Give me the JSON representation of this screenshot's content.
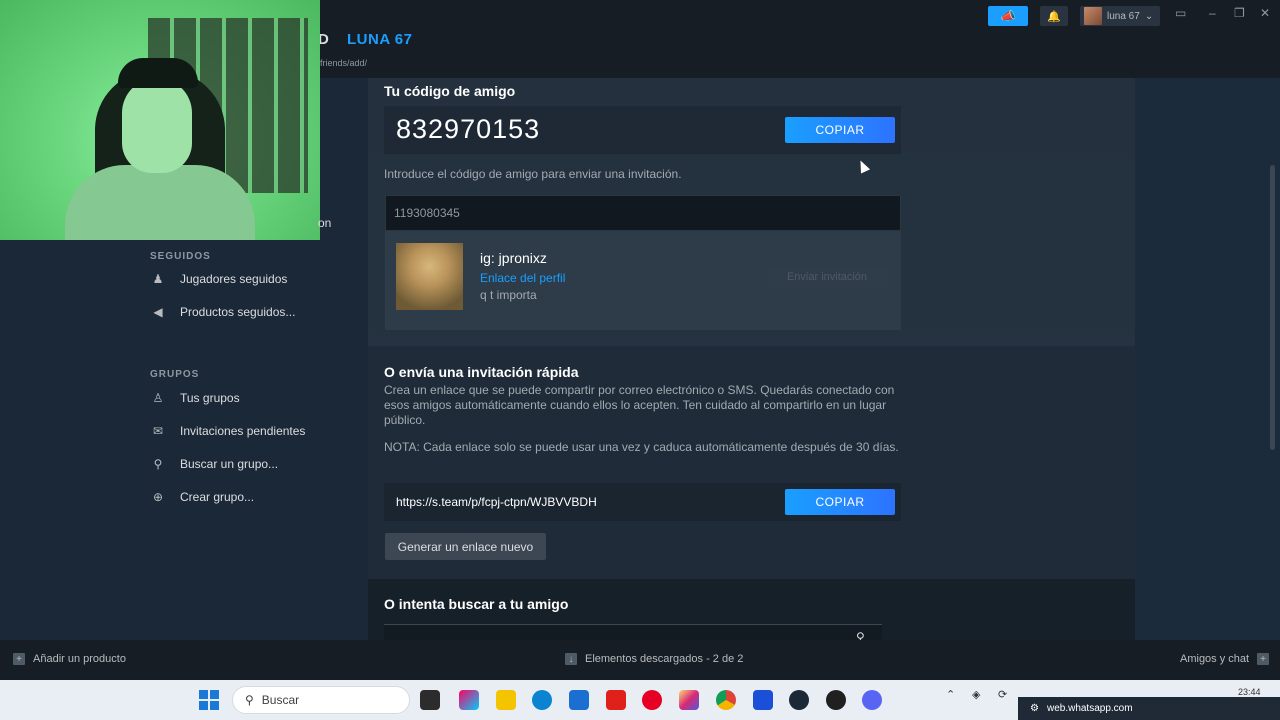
{
  "header": {
    "nav_prev": "D",
    "nav_active": "LUNA 67",
    "url": "friends/add/",
    "username": "luna 67",
    "chevron": "⌄"
  },
  "overlay": {
    "partial_text": "on"
  },
  "sidebar": {
    "followed_heading": "SEGUIDOS",
    "followed": [
      {
        "label": "Jugadores seguidos",
        "icon": "players-icon"
      },
      {
        "label": "Productos seguidos...",
        "icon": "megaphone-icon"
      }
    ],
    "groups_heading": "GRUPOS",
    "groups": [
      {
        "label": "Tus grupos",
        "icon": "group-icon"
      },
      {
        "label": "Invitaciones pendientes",
        "icon": "mail-icon"
      },
      {
        "label": "Buscar un grupo...",
        "icon": "search-icon"
      },
      {
        "label": "Crear grupo...",
        "icon": "plus-circle-icon"
      }
    ]
  },
  "friend_code": {
    "title": "Tu código de amigo",
    "code": "832970153",
    "copy_label": "COPIAR",
    "hint": "Introduce el código de amigo para enviar una invitación.",
    "input_value": "1193080345"
  },
  "friend_card": {
    "name": "ig: jpronixz",
    "profile_link": "Enlace del perfil",
    "status": "q t importa",
    "send_label": "Enviar invitación"
  },
  "quick_invite": {
    "title": "O envía una invitación rápida",
    "description": "Crea un enlace que se puede compartir por correo electrónico o SMS. Quedarás conectado con esos amigos automáticamente cuando ellos lo acepten. Ten cuidado al compartirlo en un lugar público.",
    "note": "NOTA: Cada enlace solo se puede usar una vez y caduca automáticamente después de 30 días.",
    "link": "https://s.team/p/fcpj-ctpn/WJBVVBDH",
    "copy_label": "COPIAR",
    "generate_label": "Generar un enlace nuevo"
  },
  "search_friend": {
    "title": "O intenta buscar a tu amigo"
  },
  "steam_bottom": {
    "add_product": "Añadir un producto",
    "downloads": "Elementos descargados - 2 de 2",
    "friends_chat": "Amigos y chat"
  },
  "taskbar": {
    "search_label": "Buscar",
    "notification": "web.whatsapp.com",
    "time": "23:44"
  },
  "colors": {
    "accent": "#1a9fff",
    "background": "#1b2838",
    "webcam_green": "#6ad67e"
  }
}
